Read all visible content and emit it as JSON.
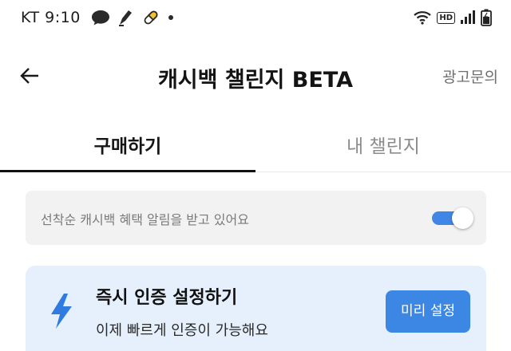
{
  "status_bar": {
    "carrier_time": "KT 9:10",
    "hd_label": "HD",
    "icons": [
      "chat-bubble-icon",
      "pen-nib-icon",
      "pill-icon",
      "dot-icon",
      "wifi-icon",
      "hd-icon",
      "signal-icon",
      "battery-icon"
    ]
  },
  "app_bar": {
    "title": "캐시백 챌린지 BETA",
    "ad_inquiry_label": "광고문의",
    "back_icon": "arrow-left-icon"
  },
  "tabs": [
    {
      "label": "구매하기",
      "active": true
    },
    {
      "label": "내 챌린지",
      "active": false
    }
  ],
  "notice": {
    "text": "선착순 캐시백 혜택 알림을 받고 있어요",
    "toggle_on": true
  },
  "promo_card": {
    "title": "즉시 인증 설정하기",
    "subtitle": "이제 빠르게 인증이 가능해요",
    "button_label": "미리 설정",
    "icon": "lightning-bolt-icon"
  },
  "colors": {
    "accent": "#3d87e4",
    "card_bg": "#e6f0fd",
    "notice_bg": "#f2f2f2"
  }
}
